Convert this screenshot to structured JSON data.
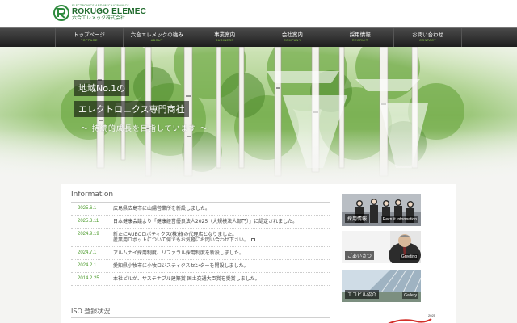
{
  "header": {
    "logo_sub": "ELECTRONICS AND MECHATRONICS",
    "logo_main": "ROKUGO ELEMEC",
    "logo_jp": "六合エレメック株式会社"
  },
  "nav": [
    {
      "label": "トップページ",
      "sub": "TOPPAGE"
    },
    {
      "label": "六合エレメックの強み",
      "sub": "ABOUT"
    },
    {
      "label": "事業案内",
      "sub": "BUSINESS"
    },
    {
      "label": "会社案内",
      "sub": "COMPANY"
    },
    {
      "label": "採用情報",
      "sub": "RECRUIT"
    },
    {
      "label": "お問い合わせ",
      "sub": "CONTACT"
    }
  ],
  "hero": {
    "line1": "地域No.1の",
    "line2": "エレクトロニクス専門商社",
    "sub": "〜 持続的成長を目指しています 〜"
  },
  "info": {
    "title": "Information",
    "news": [
      {
        "date": "2025.6.1",
        "text": "広島県広島市に山陽営業所を新設しました。"
      },
      {
        "date": "2025.3.11",
        "text": "日本健康会議より「健康経営優良法人2025（大規模法人部門）」に認定されました。"
      },
      {
        "date": "2024.9.19",
        "text": "新たにAUBOロボティクス(株)様の代理店となりました。",
        "text2": "産業用ロボットについて何でもお気軽にお問い合わせ下さい。"
      },
      {
        "date": "2024.7.1",
        "text": "アルムナイ採用制度、リファラル採用制度を新設しました。"
      },
      {
        "date": "2024.2.1",
        "text": "愛知県小牧市に小牧ロジスティクスセンターを開設しました。"
      },
      {
        "date": "2014.2.25",
        "text": "本社ビルが、サステナブル建築賞 国土交通大臣賞を受賞しました。"
      }
    ],
    "iso_title": "ISO 登録状況"
  },
  "banners": [
    {
      "jp": "採用情報",
      "en": "Recruit Information"
    },
    {
      "jp": "ごあいさつ",
      "en": "Greeting"
    },
    {
      "jp": "エコビル紹介",
      "en": "Gallery"
    }
  ],
  "award": {
    "year": "2025"
  },
  "colors": {
    "brand_green": "#2e8a3d",
    "nav_dark": "#262626",
    "date_green": "#4a9a2a"
  }
}
